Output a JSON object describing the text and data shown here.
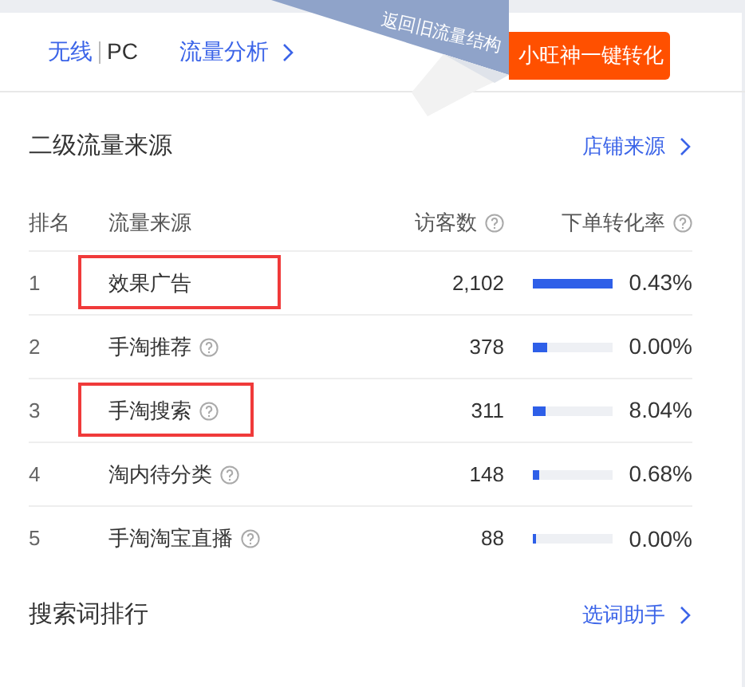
{
  "header": {
    "tabs": [
      {
        "label": "无线",
        "selected": false
      },
      {
        "label": "PC",
        "selected": true
      }
    ],
    "analysis_link": "流量分析",
    "action_button": "小旺神一键转化",
    "banner": "返回旧流量结构"
  },
  "section": {
    "title": "二级流量来源",
    "link": "店铺来源"
  },
  "table": {
    "columns": [
      "排名",
      "流量来源",
      "访客数",
      "下单转化率"
    ],
    "rows": [
      {
        "rank": "1",
        "source": "效果广告",
        "help": false,
        "visitors": "2,102",
        "level": 1.0,
        "rate": "0.43%",
        "highlighted": true
      },
      {
        "rank": "2",
        "source": "手淘推荐",
        "help": true,
        "visitors": "378",
        "level": 0.18,
        "rate": "0.00%",
        "highlighted": false
      },
      {
        "rank": "3",
        "source": "手淘搜索",
        "help": true,
        "visitors": "311",
        "level": 0.15,
        "rate": "8.04%",
        "highlighted": true
      },
      {
        "rank": "4",
        "source": "淘内待分类",
        "help": true,
        "visitors": "148",
        "level": 0.07,
        "rate": "0.68%",
        "highlighted": false
      },
      {
        "rank": "5",
        "source": "手淘淘宝直播",
        "help": true,
        "visitors": "88",
        "level": 0.04,
        "rate": "0.00%",
        "highlighted": false
      }
    ]
  },
  "footer": {
    "title": "搜索词排行",
    "link": "选词助手"
  }
}
